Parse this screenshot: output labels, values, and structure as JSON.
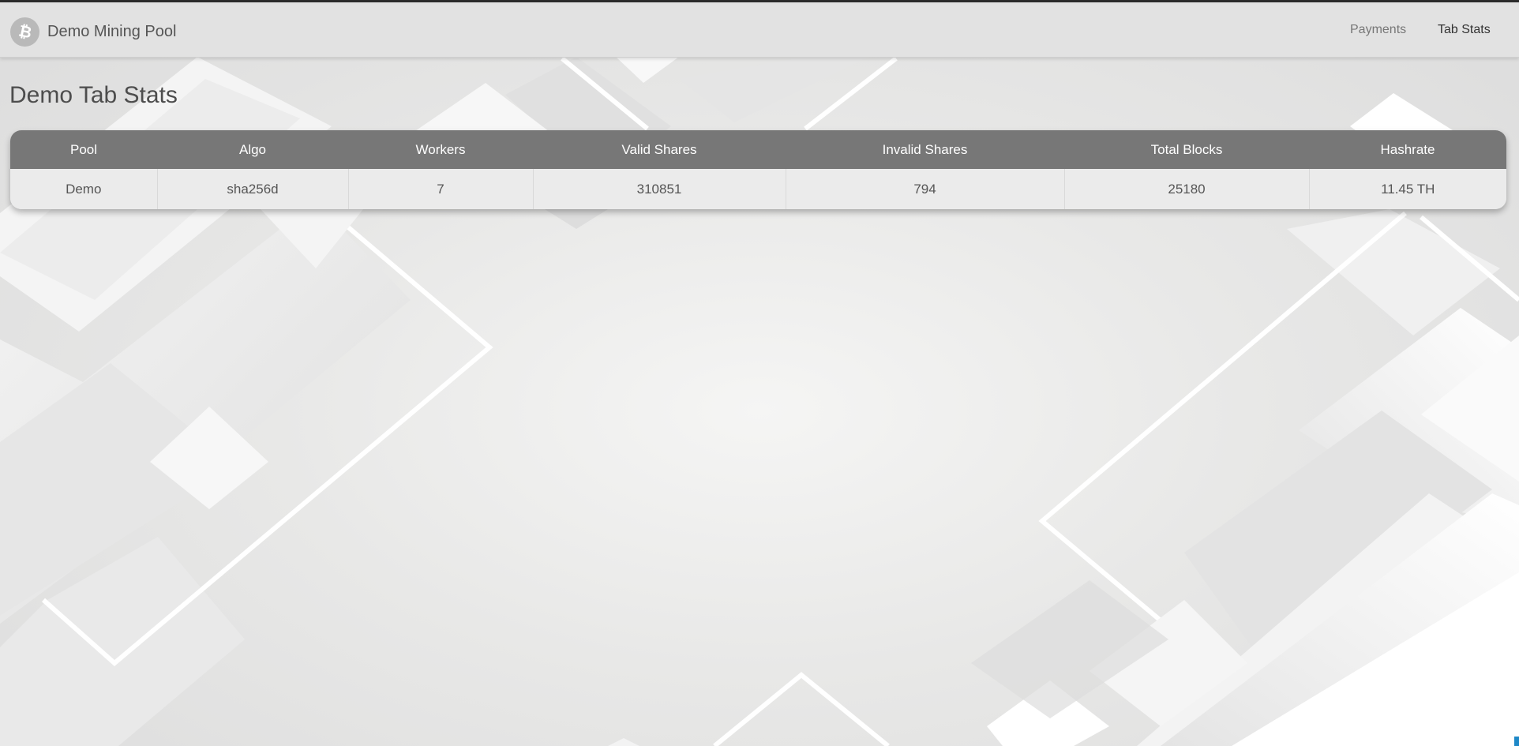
{
  "navbar": {
    "brand_title": "Demo Mining Pool",
    "brand_icon": "bitcoin-icon",
    "links": [
      {
        "label": "Payments",
        "active": false
      },
      {
        "label": "Tab Stats",
        "active": true
      }
    ]
  },
  "page": {
    "title": "Demo Tab Stats"
  },
  "stats_table": {
    "headers": [
      "Pool",
      "Algo",
      "Workers",
      "Valid Shares",
      "Invalid Shares",
      "Total Blocks",
      "Hashrate"
    ],
    "rows": [
      [
        "Demo",
        "sha256d",
        "7",
        "310851",
        "794",
        "25180",
        "11.45 TH"
      ]
    ]
  },
  "colors": {
    "navbar_bg": "#e2e2e2",
    "table_header_bg": "#777777",
    "table_row_bg": "#ebebeb",
    "accent": "#1e88c7"
  }
}
